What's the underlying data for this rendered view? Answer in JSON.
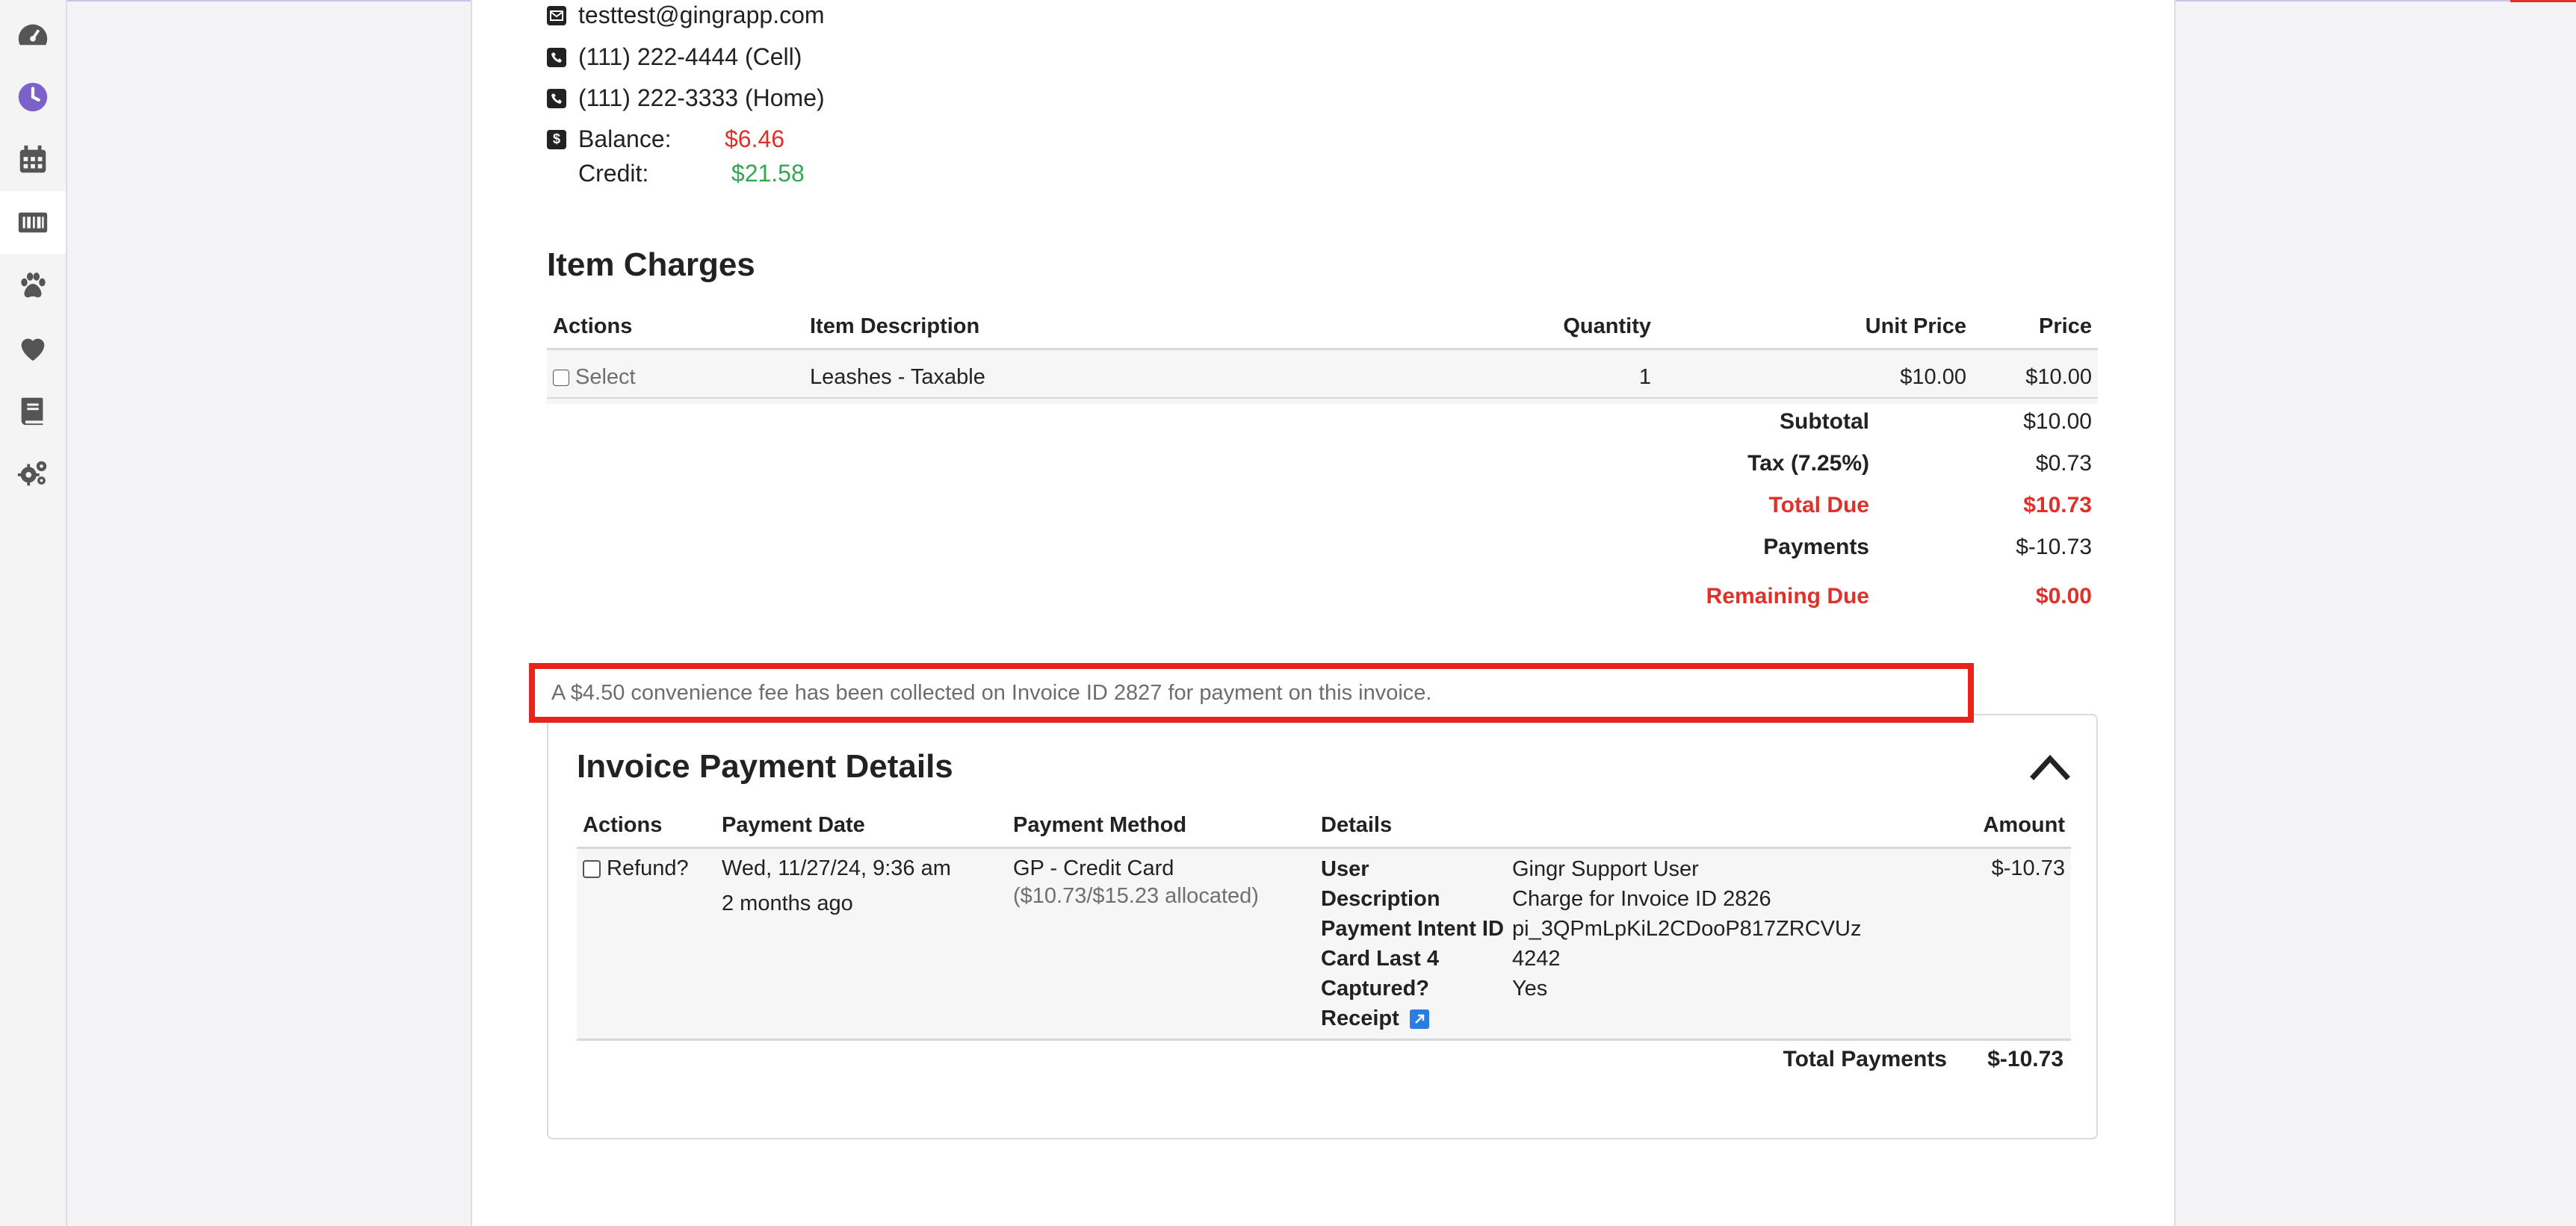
{
  "contact": {
    "email": "testtest@gingrapp.com",
    "phone_cell": "(111) 222-4444 (Cell)",
    "phone_home": "(111) 222-3333 (Home)",
    "balance_label": "Balance:",
    "balance_value": "$6.46",
    "credit_label": "Credit:",
    "credit_value": "$21.58"
  },
  "sidebar": {
    "items": [
      {
        "icon": "dashboard-icon"
      },
      {
        "icon": "clock-icon"
      },
      {
        "icon": "calendar-icon"
      },
      {
        "icon": "barcode-icon",
        "active": true
      },
      {
        "icon": "paw-icon"
      },
      {
        "icon": "heart-icon"
      },
      {
        "icon": "book-icon"
      },
      {
        "icon": "gears-icon"
      }
    ]
  },
  "item_charges": {
    "title": "Item Charges",
    "headers": {
      "actions": "Actions",
      "description": "Item Description",
      "quantity": "Quantity",
      "unit_price": "Unit Price",
      "price": "Price"
    },
    "rows": [
      {
        "select_label": "Select",
        "description": "Leashes - Taxable",
        "quantity": "1",
        "unit_price": "$10.00",
        "price": "$10.00"
      }
    ],
    "totals": {
      "subtotal_label": "Subtotal",
      "subtotal": "$10.00",
      "tax_label": "Tax (7.25%)",
      "tax": "$0.73",
      "total_due_label": "Total Due",
      "total_due": "$10.73",
      "payments_label": "Payments",
      "payments": "$-10.73",
      "remaining_label": "Remaining Due",
      "remaining": "$0.00"
    }
  },
  "notice": {
    "text": "A $4.50 convenience fee has been collected on Invoice ID  2827 for payment on this invoice."
  },
  "payment_details": {
    "title": "Invoice Payment Details",
    "headers": {
      "actions": "Actions",
      "date": "Payment Date",
      "method": "Payment Method",
      "details": "Details",
      "amount": "Amount"
    },
    "row": {
      "refund_label": "Refund?",
      "date": "Wed, 11/27/24, 9:36 am",
      "relative": "2 months ago",
      "method": "GP - Credit Card",
      "allocated": "($10.73/$15.23 allocated)",
      "amount": "$-10.73",
      "details": {
        "user_label": "User",
        "user": "Gingr Support User",
        "description_label": "Description",
        "description": "Charge for Invoice ID 2826",
        "intent_label": "Payment Intent ID",
        "intent": "pi_3QPmLpKiL2CDooP817ZRCVUz",
        "card_label": "Card Last 4",
        "card": "4242",
        "captured_label": "Captured?",
        "captured": "Yes",
        "receipt_label": "Receipt"
      }
    },
    "total_label": "Total Payments",
    "total_value": "$-10.73"
  },
  "colors": {
    "accent_purple": "#7b61c9",
    "danger_red": "#e0302a",
    "success_green": "#33a852",
    "highlight_box": "#e8231c",
    "link_blue": "#2a7de1"
  }
}
